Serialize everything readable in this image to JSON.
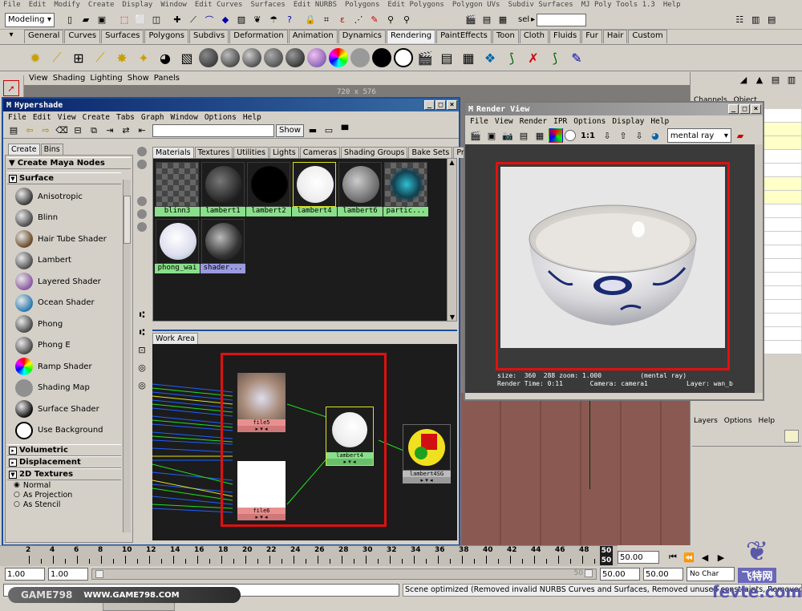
{
  "main_menu": [
    "File",
    "Edit",
    "Modify",
    "Create",
    "Display",
    "Window",
    "Edit Curves",
    "Surfaces",
    "Edit NURBS",
    "Polygons",
    "Edit Polygons",
    "Polygon UVs",
    "Subdiv Surfaces",
    "MJ Poly Tools 1.3",
    "Help"
  ],
  "mode_select": "Modeling",
  "sel_label": "sel",
  "shelf_tabs": [
    "General",
    "Curves",
    "Surfaces",
    "Polygons",
    "Subdivs",
    "Deformation",
    "Animation",
    "Dynamics",
    "Rendering",
    "PaintEffects",
    "Toon",
    "Cloth",
    "Fluids",
    "Fur",
    "Hair",
    "Custom"
  ],
  "shelf_active_tab": "Rendering",
  "viewport_menu": [
    "View",
    "Shading",
    "Lighting",
    "Show",
    "Panels"
  ],
  "viewport_resolution": "720 x 576",
  "hypershade": {
    "title": "Hypershade",
    "menu": [
      "File",
      "Edit",
      "View",
      "Create",
      "Tabs",
      "Graph",
      "Window",
      "Options",
      "Help"
    ],
    "show_button": "Show",
    "left_tabs": [
      "Create",
      "Bins"
    ],
    "create_header": "Create Maya Nodes",
    "surface_header": "Surface",
    "surface_items": [
      {
        "label": "Anisotropic",
        "color": "#3a3a3a"
      },
      {
        "label": "Blinn",
        "color": "#4a4a4a"
      },
      {
        "label": "Hair Tube Shader",
        "color": "#6a4a2a"
      },
      {
        "label": "Lambert",
        "color": "#505050"
      },
      {
        "label": "Layered Shader",
        "color": "#8a5aa0"
      },
      {
        "label": "Ocean Shader",
        "color": "#2a7ab0"
      },
      {
        "label": "Phong",
        "color": "#4a4a4a"
      },
      {
        "label": "Phong E",
        "color": "#4a4a4a"
      },
      {
        "label": "Ramp Shader",
        "color": "#d05030"
      },
      {
        "label": "Shading Map",
        "color": "#909090"
      },
      {
        "label": "Surface Shader",
        "color": "#101010"
      },
      {
        "label": "Use Background",
        "color": "#ffffff"
      }
    ],
    "volumetric_header": "Volumetric",
    "displacement_header": "Displacement",
    "textures_header": "2D Textures",
    "texture_options": [
      "Normal",
      "As Projection",
      "As Stencil"
    ],
    "material_tabs": [
      "Materials",
      "Textures",
      "Utilities",
      "Lights",
      "Cameras",
      "Shading Groups",
      "Bake Sets",
      "Projects"
    ],
    "swatches": [
      {
        "label": "blinn3",
        "kind": "checker"
      },
      {
        "label": "lambert1",
        "kind": "grey"
      },
      {
        "label": "lambert2",
        "kind": "black"
      },
      {
        "label": "lambert4",
        "kind": "white"
      },
      {
        "label": "lambert6",
        "kind": "grey2"
      },
      {
        "label": "partic...",
        "kind": "particle"
      },
      {
        "label": "phong_wai",
        "kind": "porcelain"
      },
      {
        "label": "shader...",
        "kind": "dark"
      }
    ],
    "work_area_tab": "Work Area",
    "nodes": {
      "file5": "file5",
      "file6": "file6",
      "lambert4": "lambert4",
      "sg": "lambert4SG"
    }
  },
  "render_view": {
    "title": "Render View",
    "menu": [
      "File",
      "View",
      "Render",
      "IPR",
      "Options",
      "Display",
      "Help"
    ],
    "ratio": "1:1",
    "renderer": "mental ray",
    "info_line1": "size:  360  288 zoom: 1.000          (mental ray)",
    "info_line2": "Render Time: 0:11       Camera: camera1          Layer: wan_b"
  },
  "channel_box": {
    "tabs": [
      "Channels",
      "Object"
    ],
    "layers_menu": [
      "Layers",
      "Options",
      "Help"
    ]
  },
  "timeline": {
    "ticks": [
      "2",
      "4",
      "6",
      "8",
      "10",
      "12",
      "14",
      "16",
      "18",
      "20",
      "22",
      "24",
      "26",
      "28",
      "30",
      "32",
      "34",
      "36",
      "38",
      "40",
      "42",
      "44",
      "46",
      "48"
    ],
    "current_frame": "50",
    "end_frame_top": "50",
    "end_field": "50.00"
  },
  "range_slider": {
    "start": "1.00",
    "start2": "1.00",
    "end": "50.00",
    "end2": "50.00",
    "range_end": "50",
    "char_set": "No Char"
  },
  "status_message": "Scene optimized (Removed invalid NURBS Curves and Surfaces, Removed unused constraints, Removed unu...aces, Re",
  "watermark": {
    "left_brand": "GAME798",
    "left_url": "WWW.GAME798.COM",
    "right_brand": "飞特网",
    "right_url": "fevte.com"
  },
  "colors": {
    "highlight_red": "#e01010",
    "title_blue": "#0a246a",
    "swatch_green": "#8ae08a"
  }
}
